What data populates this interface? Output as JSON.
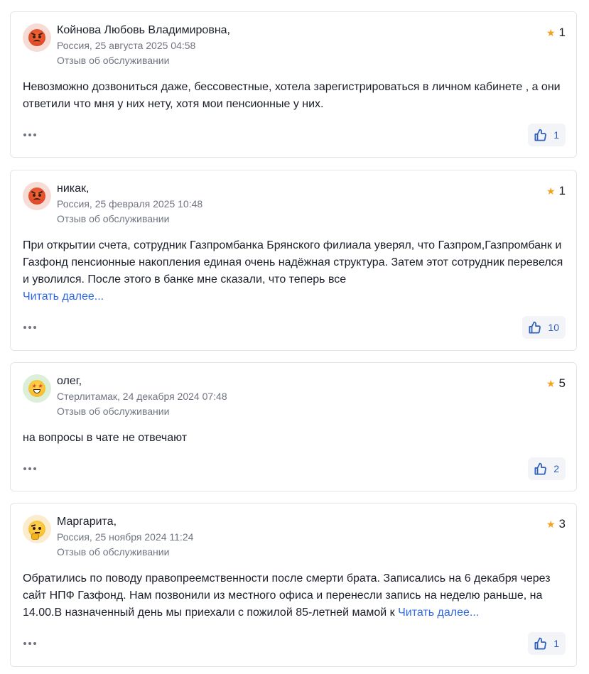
{
  "reviews": [
    {
      "author": "Койнова Любовь Владимировна,",
      "meta": "Россия, 25 августа 2025 04:58",
      "category": "Отзыв об обслуживании",
      "rating": "1",
      "mood_icon": "angry-face-icon",
      "text": "Невозможно дозвониться даже, бессовестные, хотела зарегистрироваться в личном кабинете , а они ответили что мня у них нету, хотя мои пенсионные у них.",
      "read_more": "",
      "likes": "1"
    },
    {
      "author": "никак,",
      "meta": "Россия, 25 февраля 2025 10:48",
      "category": "Отзыв об обслуживании",
      "rating": "1",
      "mood_icon": "angry-face-icon",
      "text": "При открытии счета, сотрудник Газпромбанка Брянского филиала уверял, что Газпром,Газпромбанк и Газфонд пенсионные накопления единая очень надёжная структура. Затем этот сотрудник перевелся и уволился. После этого в банке мне сказали, что теперь все",
      "read_more": "Читать далее...",
      "likes": "10"
    },
    {
      "author": "олег,",
      "meta": "Стерлитамак, 24 декабря 2024 07:48",
      "category": "Отзыв об обслуживании",
      "rating": "5",
      "mood_icon": "star-struck-face-icon",
      "text": "на вопросы в чате не отвечают",
      "read_more": "",
      "likes": "2"
    },
    {
      "author": "Маргарита,",
      "meta": "Россия, 25 ноября 2024 11:24",
      "category": "Отзыв об обслуживании",
      "rating": "3",
      "mood_icon": "thinking-face-icon",
      "text": "Обратились по поводу правопреемственности после смерти брата. Записались на 6 декабря через сайт НПФ Газфонд. Нам позвонили из местного офиса и перенесли запись на неделю раньше, на 14.00.В назначенный день мы приехали с пожилой 85-летней мамой к",
      "read_more": "Читать далее...",
      "likes": "1"
    }
  ],
  "colors": {
    "star": "#f4a21d",
    "link": "#2f6ae0",
    "like_bg": "#f2f4f7",
    "like_icon": "#2f5fb8"
  }
}
